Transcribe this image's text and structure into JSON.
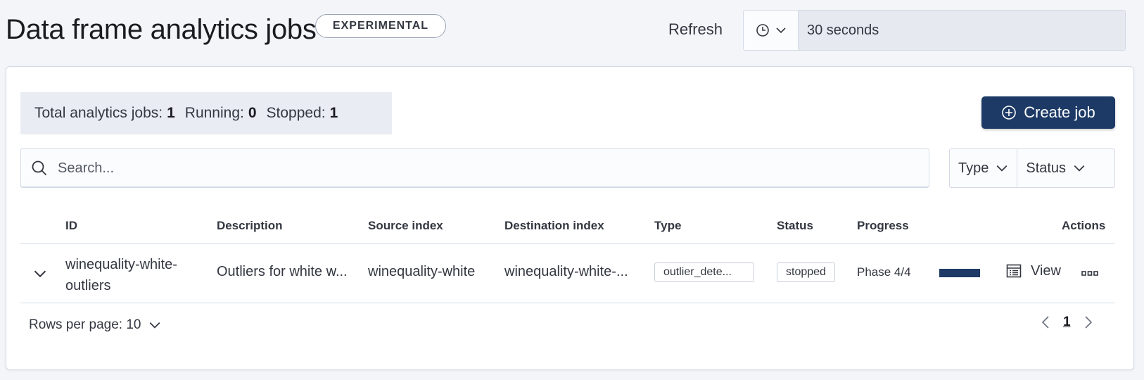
{
  "header": {
    "title": "Data frame analytics jobs",
    "badge": "EXPERIMENTAL",
    "refresh_label": "Refresh",
    "refresh_value": "30 seconds"
  },
  "stats": {
    "total_label": "Total analytics jobs:",
    "total_value": "1",
    "running_label": "Running:",
    "running_value": "0",
    "stopped_label": "Stopped:",
    "stopped_value": "1"
  },
  "create_button": {
    "label": "Create job"
  },
  "search": {
    "placeholder": "Search..."
  },
  "filters": {
    "type_label": "Type",
    "status_label": "Status"
  },
  "table": {
    "columns": {
      "id": "ID",
      "description": "Description",
      "source": "Source index",
      "destination": "Destination index",
      "type": "Type",
      "status": "Status",
      "progress": "Progress",
      "actions": "Actions"
    },
    "rows": [
      {
        "id_line1": "winequality-white-",
        "id_line2": "outliers",
        "description": "Outliers for white w...",
        "source": "winequality-white",
        "destination": "winequality-white-...",
        "type": "outlier_dete...",
        "status": "stopped",
        "phase": "Phase 4/4",
        "progress_fraction": 1.0,
        "view_label": "View"
      }
    ]
  },
  "pagination": {
    "rows_per_page": "Rows per page: 10",
    "current_page": "1"
  },
  "colors": {
    "primary": "#1d3a66",
    "border": "#d3dae6",
    "background": "#f4f5f9"
  },
  "icons": {
    "clock": "clock-icon",
    "search": "search-icon",
    "plus_circle": "plus-circle-icon",
    "chevron_down": "chevron-down-icon",
    "table_view": "table-view-icon",
    "more": "more-horizontal-icon"
  }
}
